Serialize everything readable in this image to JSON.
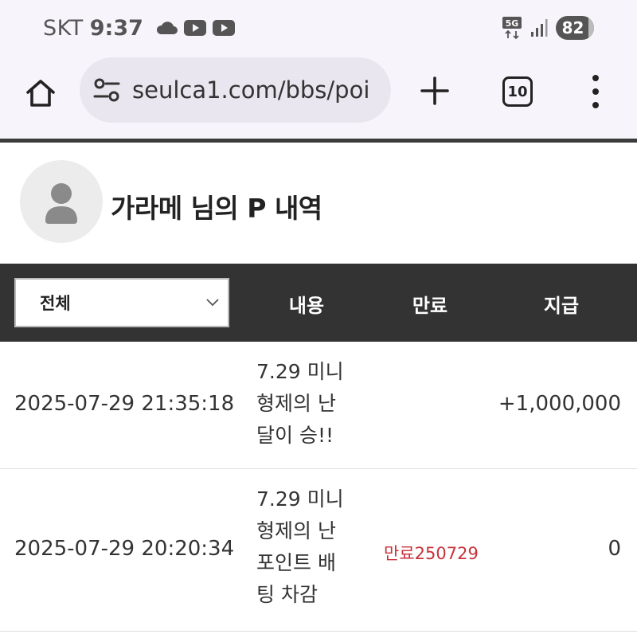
{
  "status_bar": {
    "carrier": "SKT",
    "time": "9:37",
    "network": "5G",
    "battery": "82"
  },
  "browser": {
    "url": "seulca1.com/bbs/poi",
    "tab_count": "10"
  },
  "profile": {
    "title": "가라메 님의 P 내역"
  },
  "table": {
    "filter_selected": "전체",
    "headers": {
      "content": "내용",
      "expire": "만료",
      "pay": "지급"
    },
    "rows": [
      {
        "date": "2025-07-29 21:35:18",
        "content_lines": [
          "7.29 미니",
          "형제의 난",
          "달이 승!!"
        ],
        "expire": "",
        "pay": "+1,000,000"
      },
      {
        "date": "2025-07-29 20:20:34",
        "content_lines": [
          "7.29 미니",
          "형제의 난",
          "포인트 배",
          "팅 차감"
        ],
        "expire": "만료250729",
        "pay": "0"
      }
    ]
  },
  "colors": {
    "header_bg": "#333333",
    "expire_red": "#c8323a",
    "chrome_bg": "#f7f5fb"
  }
}
